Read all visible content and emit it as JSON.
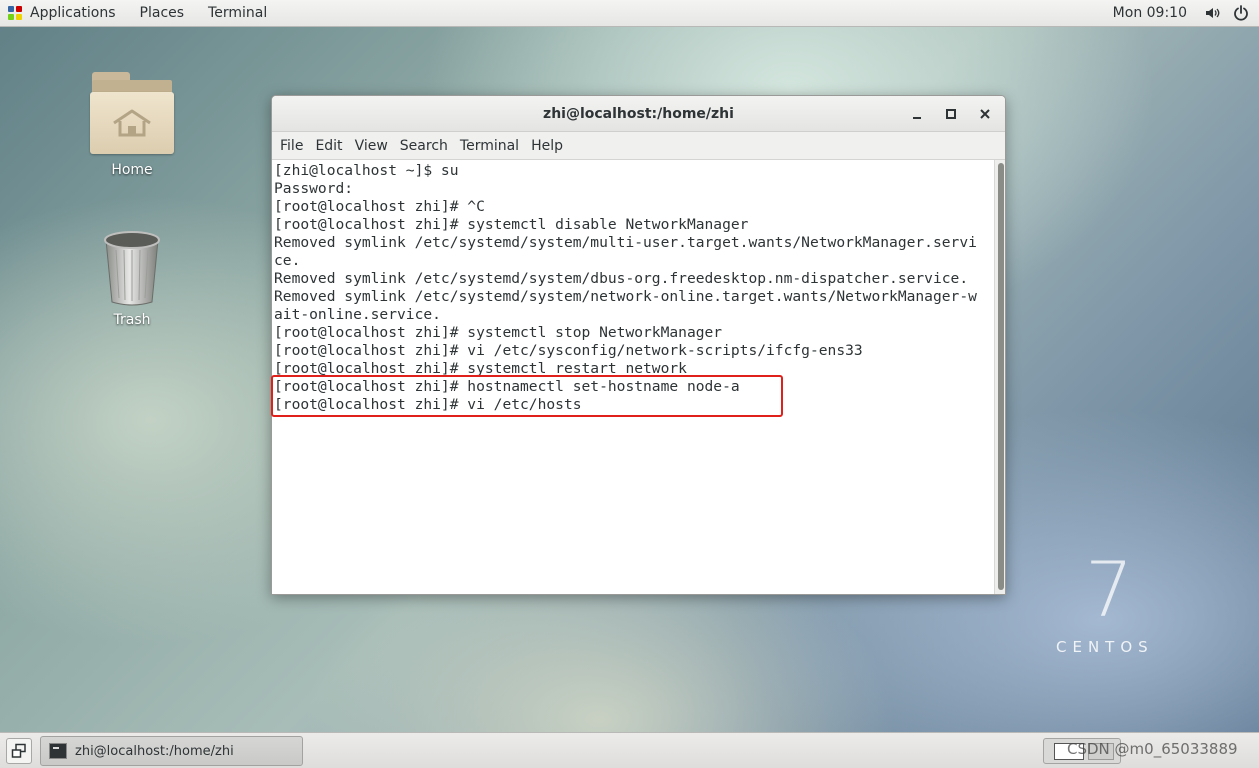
{
  "topbar": {
    "applications": "Applications",
    "places": "Places",
    "terminal": "Terminal",
    "clock": "Mon 09:10",
    "icons": [
      "applications-icon",
      "volume-icon",
      "power-icon"
    ]
  },
  "desktop": {
    "icons": [
      {
        "label": "Home",
        "icon": "home-folder-icon"
      },
      {
        "label": "Trash",
        "icon": "trash-icon"
      }
    ],
    "brand_number": "7",
    "brand_word": "CENTOS"
  },
  "window": {
    "title": "zhi@localhost:/home/zhi",
    "controls": [
      "minimize-icon",
      "maximize-icon",
      "close-icon"
    ],
    "menu": [
      "File",
      "Edit",
      "View",
      "Search",
      "Terminal",
      "Help"
    ],
    "lines": [
      "[zhi@localhost ~]$ su",
      "Password:",
      "[root@localhost zhi]# ^C",
      "[root@localhost zhi]# systemctl disable NetworkManager",
      "Removed symlink /etc/systemd/system/multi-user.target.wants/NetworkManager.servi",
      "ce.",
      "Removed symlink /etc/systemd/system/dbus-org.freedesktop.nm-dispatcher.service.",
      "Removed symlink /etc/systemd/system/network-online.target.wants/NetworkManager-w",
      "ait-online.service.",
      "[root@localhost zhi]# systemctl stop NetworkManager",
      "[root@localhost zhi]# vi /etc/sysconfig/network-scripts/ifcfg-ens33",
      "[root@localhost zhi]# systemctl restart network",
      "[root@localhost zhi]# hostnamectl set-hostname node-a",
      "[root@localhost zhi]# vi /etc/hosts"
    ]
  },
  "taskbar": {
    "task_label": "zhi@localhost:/home/zhi",
    "watermark": "CSDN @m0_65033889"
  },
  "colors": {
    "highlight": "#e0211b",
    "terminal_bg": "#ffffff",
    "terminal_fg": "#2e3436"
  }
}
